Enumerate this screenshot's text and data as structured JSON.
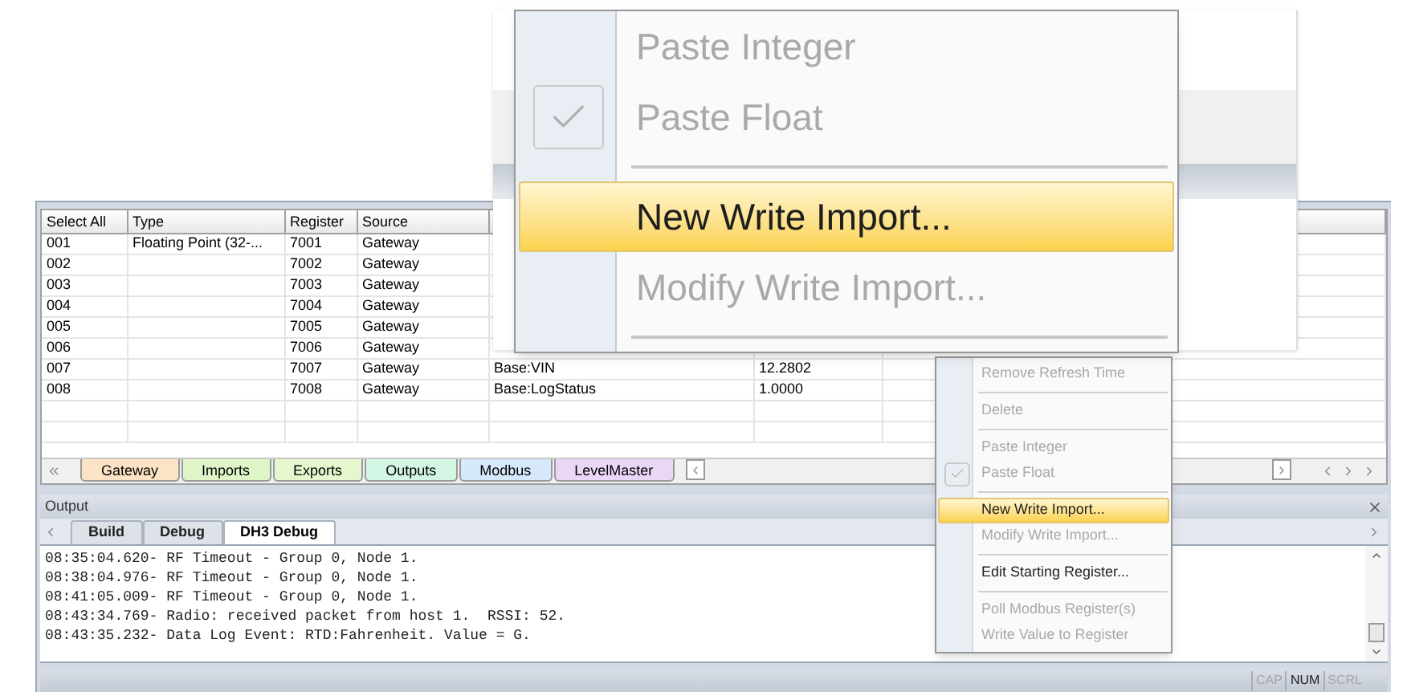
{
  "table": {
    "columns": [
      "Select All",
      "Type",
      "Register",
      "Source"
    ],
    "rows": [
      {
        "select_all": "001",
        "type": "Floating Point (32-...",
        "register": "7001",
        "source": "Gateway"
      },
      {
        "select_all": "002",
        "register": "7002",
        "source": "Gateway"
      },
      {
        "select_all": "003",
        "register": "7003",
        "source": "Gateway"
      },
      {
        "select_all": "004",
        "register": "7004",
        "source": "Gateway"
      },
      {
        "select_all": "005",
        "register": "7005",
        "source": "Gateway"
      },
      {
        "select_all": "006",
        "register": "7006",
        "source": "Gateway"
      },
      {
        "select_all": "007",
        "register": "7007",
        "source": "Gateway",
        "column_5": "Base:VIN",
        "column_6": "12.2802"
      },
      {
        "select_all": "008",
        "register": "7008",
        "source": "Gateway",
        "column_5": "Base:LogStatus",
        "column_6": "1.0000"
      }
    ]
  },
  "sheet_tabs": [
    {
      "label": "Gateway",
      "color": "#fde3c6"
    },
    {
      "label": "Imports",
      "color": "#dff5c8"
    },
    {
      "label": "Exports",
      "color": "#e6f7cf"
    },
    {
      "label": "Outputs",
      "color": "#d3f5e4"
    },
    {
      "label": "Modbus",
      "color": "#d6e8fb"
    },
    {
      "label": "LevelMaster",
      "color": "#ead7f7"
    }
  ],
  "output": {
    "title": "Output",
    "tabs": [
      {
        "label": "Build",
        "selected": false
      },
      {
        "label": "Debug",
        "selected": false
      },
      {
        "label": "DH3 Debug",
        "selected": true
      }
    ],
    "lines": [
      "08:35:04.620- RF Timeout - Group 0, Node 1.",
      "08:38:04.976- RF Timeout - Group 0, Node 1.",
      "08:41:05.009- RF Timeout - Group 0, Node 1.",
      "08:43:34.769- Radio: received packet from host 1.  RSSI: 52.",
      "08:43:35.232- Data Log Event: RTD:Fahrenheit. Value = G."
    ]
  },
  "context_menu": {
    "items": [
      {
        "kind": "item",
        "label": "Remove Refresh Time",
        "disabled": true,
        "checked": false,
        "selected": false
      },
      {
        "kind": "separator"
      },
      {
        "kind": "item",
        "label": "Delete",
        "disabled": true,
        "checked": false,
        "selected": false
      },
      {
        "kind": "separator"
      },
      {
        "kind": "item",
        "label": "Paste Integer",
        "disabled": true,
        "checked": false,
        "selected": false
      },
      {
        "kind": "item",
        "label": "Paste Float",
        "disabled": true,
        "checked": true,
        "selected": false
      },
      {
        "kind": "separator"
      },
      {
        "kind": "item",
        "label": "New Write Import...",
        "disabled": false,
        "checked": false,
        "selected": true
      },
      {
        "kind": "item",
        "label": "Modify Write Import...",
        "disabled": true,
        "checked": false,
        "selected": false
      },
      {
        "kind": "separator"
      },
      {
        "kind": "item",
        "label": "Edit Starting Register...",
        "disabled": false,
        "checked": false,
        "selected": false
      },
      {
        "kind": "separator"
      },
      {
        "kind": "item",
        "label": "Poll Modbus Register(s)",
        "disabled": true,
        "checked": false,
        "selected": false
      },
      {
        "kind": "item",
        "label": "Write Value to Register",
        "disabled": true,
        "checked": false,
        "selected": false
      }
    ]
  },
  "magnifier": {
    "items": [
      {
        "kind": "item",
        "label": "Paste Integer",
        "disabled": true,
        "checked": false,
        "selected": false
      },
      {
        "kind": "item",
        "label": "Paste Float",
        "disabled": true,
        "checked": true,
        "selected": false
      },
      {
        "kind": "separator"
      },
      {
        "kind": "item",
        "label": "New Write Import...",
        "disabled": false,
        "checked": false,
        "selected": true
      },
      {
        "kind": "item",
        "label": "Modify Write Import...",
        "disabled": true,
        "checked": false,
        "selected": false
      },
      {
        "kind": "separator"
      }
    ]
  },
  "status_bar": {
    "indicators": [
      {
        "label": "CAP",
        "on": false
      },
      {
        "label": "NUM",
        "on": true
      },
      {
        "label": "SCRL",
        "on": false
      }
    ]
  }
}
